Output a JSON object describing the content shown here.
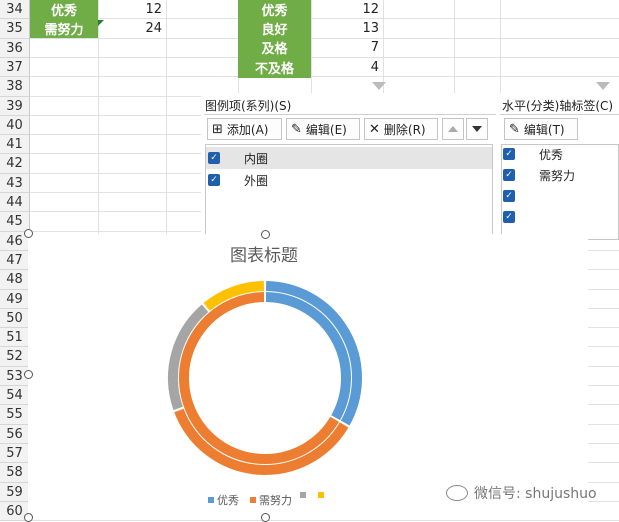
{
  "rows": [
    "34",
    "35",
    "36",
    "37",
    "38",
    "39",
    "40",
    "41",
    "42",
    "43",
    "44",
    "45",
    "46",
    "47",
    "48",
    "49",
    "50",
    "51",
    "52",
    "53",
    "54",
    "55",
    "56",
    "57",
    "58",
    "59",
    "60"
  ],
  "left_table": [
    {
      "label": "优秀",
      "value": "12"
    },
    {
      "label": "需努力",
      "value": "24"
    }
  ],
  "right_table": [
    {
      "label": "优秀",
      "value": "12"
    },
    {
      "label": "良好",
      "value": "13"
    },
    {
      "label": "及格",
      "value": "7"
    },
    {
      "label": "不及格",
      "value": "4"
    }
  ],
  "series_panel": {
    "title": "图例项(系列)(S)",
    "add": "添加(A)",
    "edit": "编辑(E)",
    "delete": "删除(R)",
    "items": [
      "内圈",
      "外圈"
    ]
  },
  "axis_panel": {
    "title": "水平(分类)轴标签(C)",
    "edit": "编辑(T)",
    "items": [
      "优秀",
      "需努力",
      "",
      ""
    ]
  },
  "colors": {
    "blue": "#5b9bd5",
    "orange": "#ed7d31",
    "gray": "#a5a5a5",
    "yellow": "#ffc000",
    "green_header": "#70ad47"
  },
  "chart_data": {
    "type": "pie",
    "title": "图表标题",
    "variant": "doughnut",
    "series": [
      {
        "name": "内圈",
        "categories": [
          "优秀",
          "需努力"
        ],
        "values": [
          12,
          24
        ]
      },
      {
        "name": "外圈",
        "categories": [
          "优秀",
          "良好",
          "及格",
          "不及格"
        ],
        "values": [
          12,
          13,
          7,
          4
        ]
      }
    ],
    "legend": [
      "优秀",
      "需努力",
      "",
      ""
    ],
    "legend_position": "bottom"
  },
  "watermark": "微信号: shujushuo"
}
